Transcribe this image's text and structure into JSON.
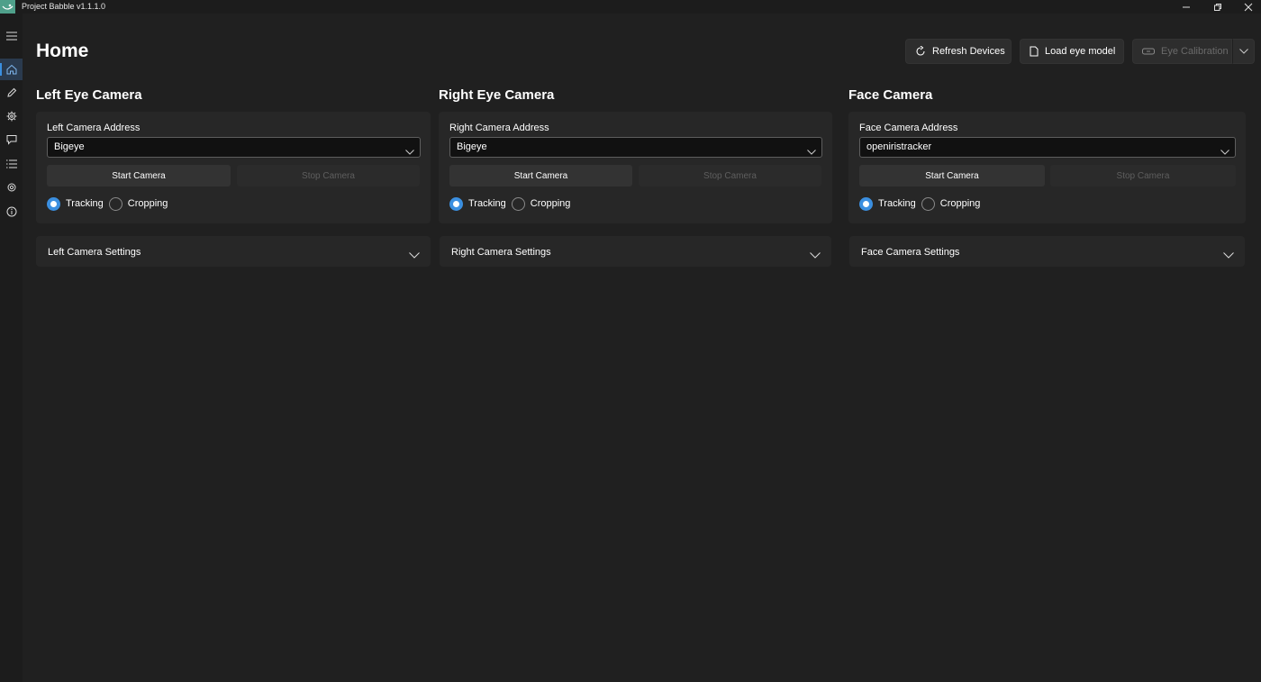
{
  "app": {
    "title": "Project Babble v1.1.1.0"
  },
  "window_controls": [
    "minimize-icon",
    "restore-icon",
    "close-icon"
  ],
  "sidebar": {
    "items": [
      {
        "icon": "hamburger-menu-icon",
        "active": false
      },
      {
        "icon": "home-icon",
        "active": true
      },
      {
        "icon": "pencil-icon",
        "active": false
      },
      {
        "icon": "cog-icon",
        "active": false
      },
      {
        "icon": "chat-bubble-icon",
        "active": false
      },
      {
        "icon": "list-icon",
        "active": false
      },
      {
        "icon": "gear-icon",
        "active": false
      },
      {
        "icon": "info-icon",
        "active": false
      }
    ]
  },
  "page": {
    "title": "Home"
  },
  "toolbar": {
    "refresh_label": "Refresh Devices",
    "load_model_label": "Load eye model",
    "calibration_label": "Eye Calibration"
  },
  "cameras": {
    "left": {
      "title": "Left Eye Camera",
      "address_label": "Left Camera Address",
      "address_value": "Bigeye",
      "start_label": "Start Camera",
      "stop_label": "Stop Camera",
      "mode_tracking": "Tracking",
      "mode_cropping": "Cropping",
      "selected_mode": "Tracking",
      "settings_label": "Left Camera Settings"
    },
    "right": {
      "title": "Right Eye Camera",
      "address_label": "Right Camera Address",
      "address_value": "Bigeye",
      "start_label": "Start Camera",
      "stop_label": "Stop Camera",
      "mode_tracking": "Tracking",
      "mode_cropping": "Cropping",
      "selected_mode": "Tracking",
      "settings_label": "Right Camera Settings"
    },
    "face": {
      "title": "Face Camera",
      "address_label": "Face Camera Address",
      "address_value": "openiristracker",
      "start_label": "Start Camera",
      "stop_label": "Stop Camera",
      "mode_tracking": "Tracking",
      "mode_cropping": "Cropping",
      "selected_mode": "Tracking",
      "settings_label": "Face Camera Settings"
    }
  },
  "colors": {
    "accent": "#3b8fe0",
    "logo": "#4fa08a",
    "background": "#202020"
  }
}
